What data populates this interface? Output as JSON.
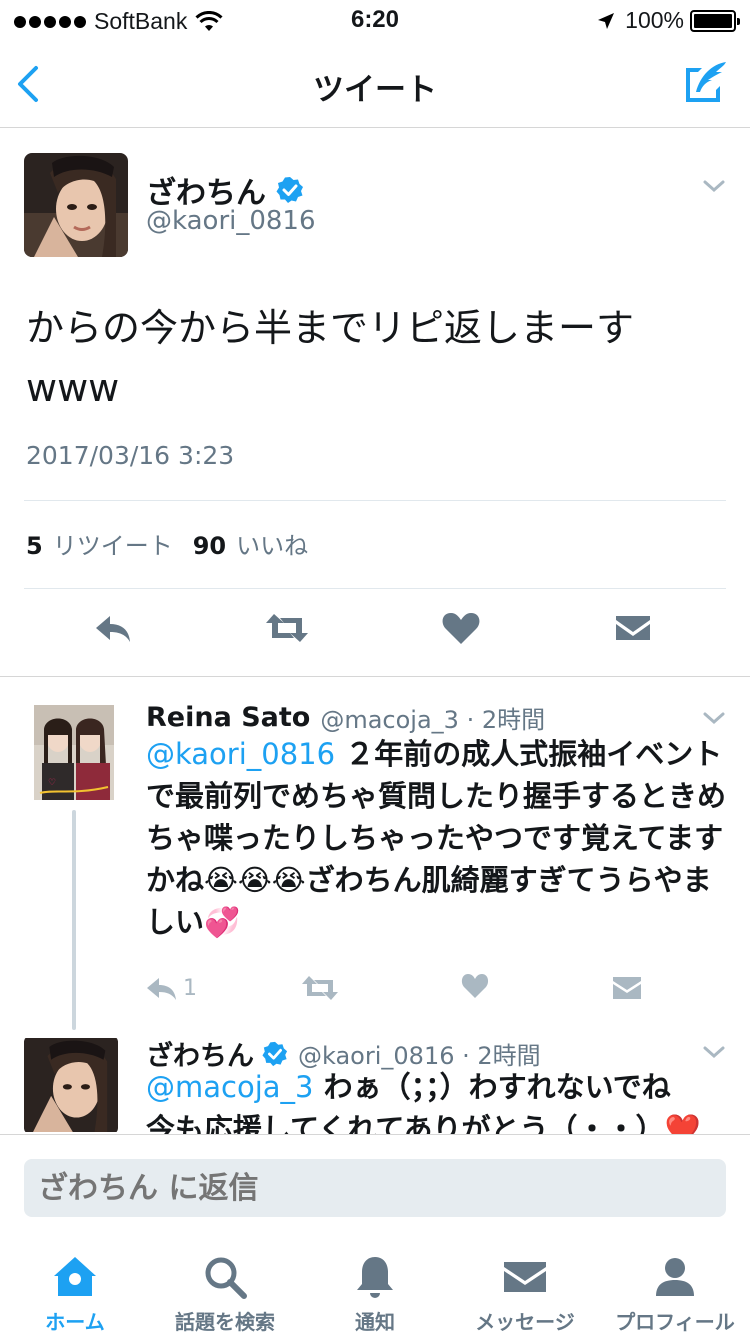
{
  "status_bar": {
    "carrier": "SoftBank",
    "time": "6:20",
    "battery": "100%"
  },
  "nav": {
    "title": "ツイート"
  },
  "main_tweet": {
    "name": "ざわちん",
    "handle": "@kaori_0816",
    "text_line1": "からの今から半までリピ返しまーす",
    "text_line2": "www",
    "date": "2017/03/16 3:23",
    "retweet_count": "5",
    "retweet_label": "リツイート",
    "like_count": "90",
    "like_label": "いいね"
  },
  "replies": [
    {
      "name": "Reina Sato",
      "meta": "@macoja_3 · 2時間",
      "mention": "@kaori_0816",
      "text": " ２年前の成人式振袖イベントで最前列でめちゃ質問したり握手するときめちゃ喋ったりしちゃったやつです覚えてますかね😭😭😭ざわちん肌綺麗すぎてうらやましい💞",
      "reply_count": "1"
    },
    {
      "name": "ざわちん",
      "meta": "@kaori_0816 · 2時間",
      "mention": "@macoja_3",
      "text_line1": " わぁ（；；）わすれないでね",
      "text_line2": "今も応援してくれてありがとう（・・）❤️"
    }
  ],
  "reply_box": {
    "placeholder": "ざわちん に返信"
  },
  "tabs": [
    {
      "label": "ホーム",
      "icon": "home-icon",
      "active": true
    },
    {
      "label": "話題を検索",
      "icon": "search-icon",
      "active": false
    },
    {
      "label": "通知",
      "icon": "bell-icon",
      "active": false
    },
    {
      "label": "メッセージ",
      "icon": "envelope-icon",
      "active": false
    },
    {
      "label": "プロフィール",
      "icon": "person-icon",
      "active": false
    }
  ],
  "colors": {
    "accent": "#1da1f2",
    "secondary_text": "#657786",
    "action_icon": "#657786",
    "action_icon_light": "#aab8c2"
  }
}
